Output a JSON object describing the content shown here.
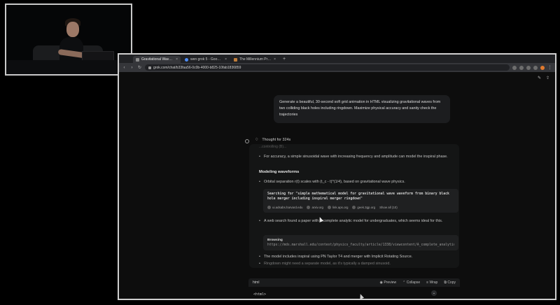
{
  "tabs": [
    {
      "label": "Gravitational Waves Animati...",
      "favicon": "tab-icon",
      "active": true
    },
    {
      "label": "wen grok 5 - Google Search",
      "favicon": "google-icon",
      "active": false
    },
    {
      "label": "The Millennium Prize Proble...",
      "favicon": "page-icon",
      "active": false
    }
  ],
  "tab_close": "×",
  "new_tab": "+",
  "address_bar": {
    "url": "grok.com/chat/b33faa56-0c0b-4000-b825-10fab1836859"
  },
  "conversation": {
    "prompt": "Generate a beautiful, 30-second soft grid animation in HTML visualizing gravitational waves from two colliding black holes including ringdown. Maximize physical accuracy and sanity check the trajectories",
    "thought_label": "Thought for 324s",
    "faded_line": "...controlling (B)...",
    "bullet_1": "For accuracy, a simple sinusoidal wave with increasing frequency and amplitude can model the inspiral phase.",
    "heading": "Modeling waveforms",
    "bullet_2": "Orbital separation r(t) scales with (t_c - t)^(1/4), based on gravitational wave physics.",
    "search_box": {
      "text": "Searching for \"simple mathematical model for gravitational wave waveform from binary black hole merger including inspiral merger ringdown\"",
      "sources": [
        "ui.adsabs.harvard.edu",
        "arxiv.org",
        "link.aps.org",
        "geek.3gp.org"
      ],
      "show_all": "Show all (10)"
    },
    "bullet_3": "A web search found a paper with a complete analytic model for undergraduates, which seems ideal for this.",
    "browsing_box": {
      "label": "Browsing",
      "url": "https://mds.marshall.edu/context/physics_faculty/article/1338/viewcontent/A_complete_analytic..."
    },
    "bullet_4": "The model includes inspiral using PN Taylor T4 and merger with Implicit Rotating Source.",
    "bullet_5": "Ringdown might need a separate model, as it's typically a damped sinusoid."
  },
  "code_block": {
    "language": "html",
    "actions": [
      "Preview",
      "Collapse",
      "Wrap",
      "Copy"
    ],
    "first_line": "<html>"
  },
  "colors": {
    "background": "#000000",
    "browser_bg": "#0d0d0d",
    "panel_bg": "#141515",
    "prompt_bg": "#1c1d1f"
  }
}
